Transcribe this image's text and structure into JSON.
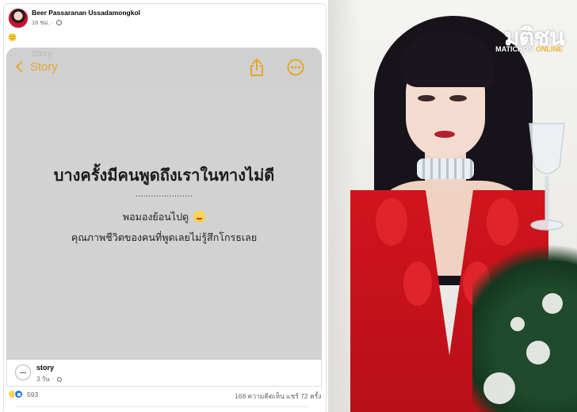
{
  "post": {
    "author": "Beer Passaranan Ussadamongkol",
    "time": "16 ชม.",
    "caption_emoji": "🙂",
    "note": {
      "ghost_text": "Story",
      "back_label": "Story",
      "title": "บางครั้งมีคนพูดถึงเราในทางไม่ดี",
      "dots": "......................",
      "line1": "พอมองย้อนไปดู",
      "line2": "คุณภาพชีวิตของคนที่พูดเลยไม่รู้สึกโกรธเลย"
    },
    "link": {
      "title": "story",
      "time": "3 วัน"
    },
    "footer": {
      "reaction_count": "593",
      "comments": "168 ความคิดเห็น",
      "shares": "แชร์ 72 ครั้ง"
    }
  },
  "logo": {
    "main": "มติชน",
    "sub_a": "MATICHON",
    "sub_b": "ONLINE"
  },
  "colors": {
    "notes_accent": "#e4a82b",
    "dress_red": "#d1141d",
    "facebook_blue": "#1877f2"
  }
}
